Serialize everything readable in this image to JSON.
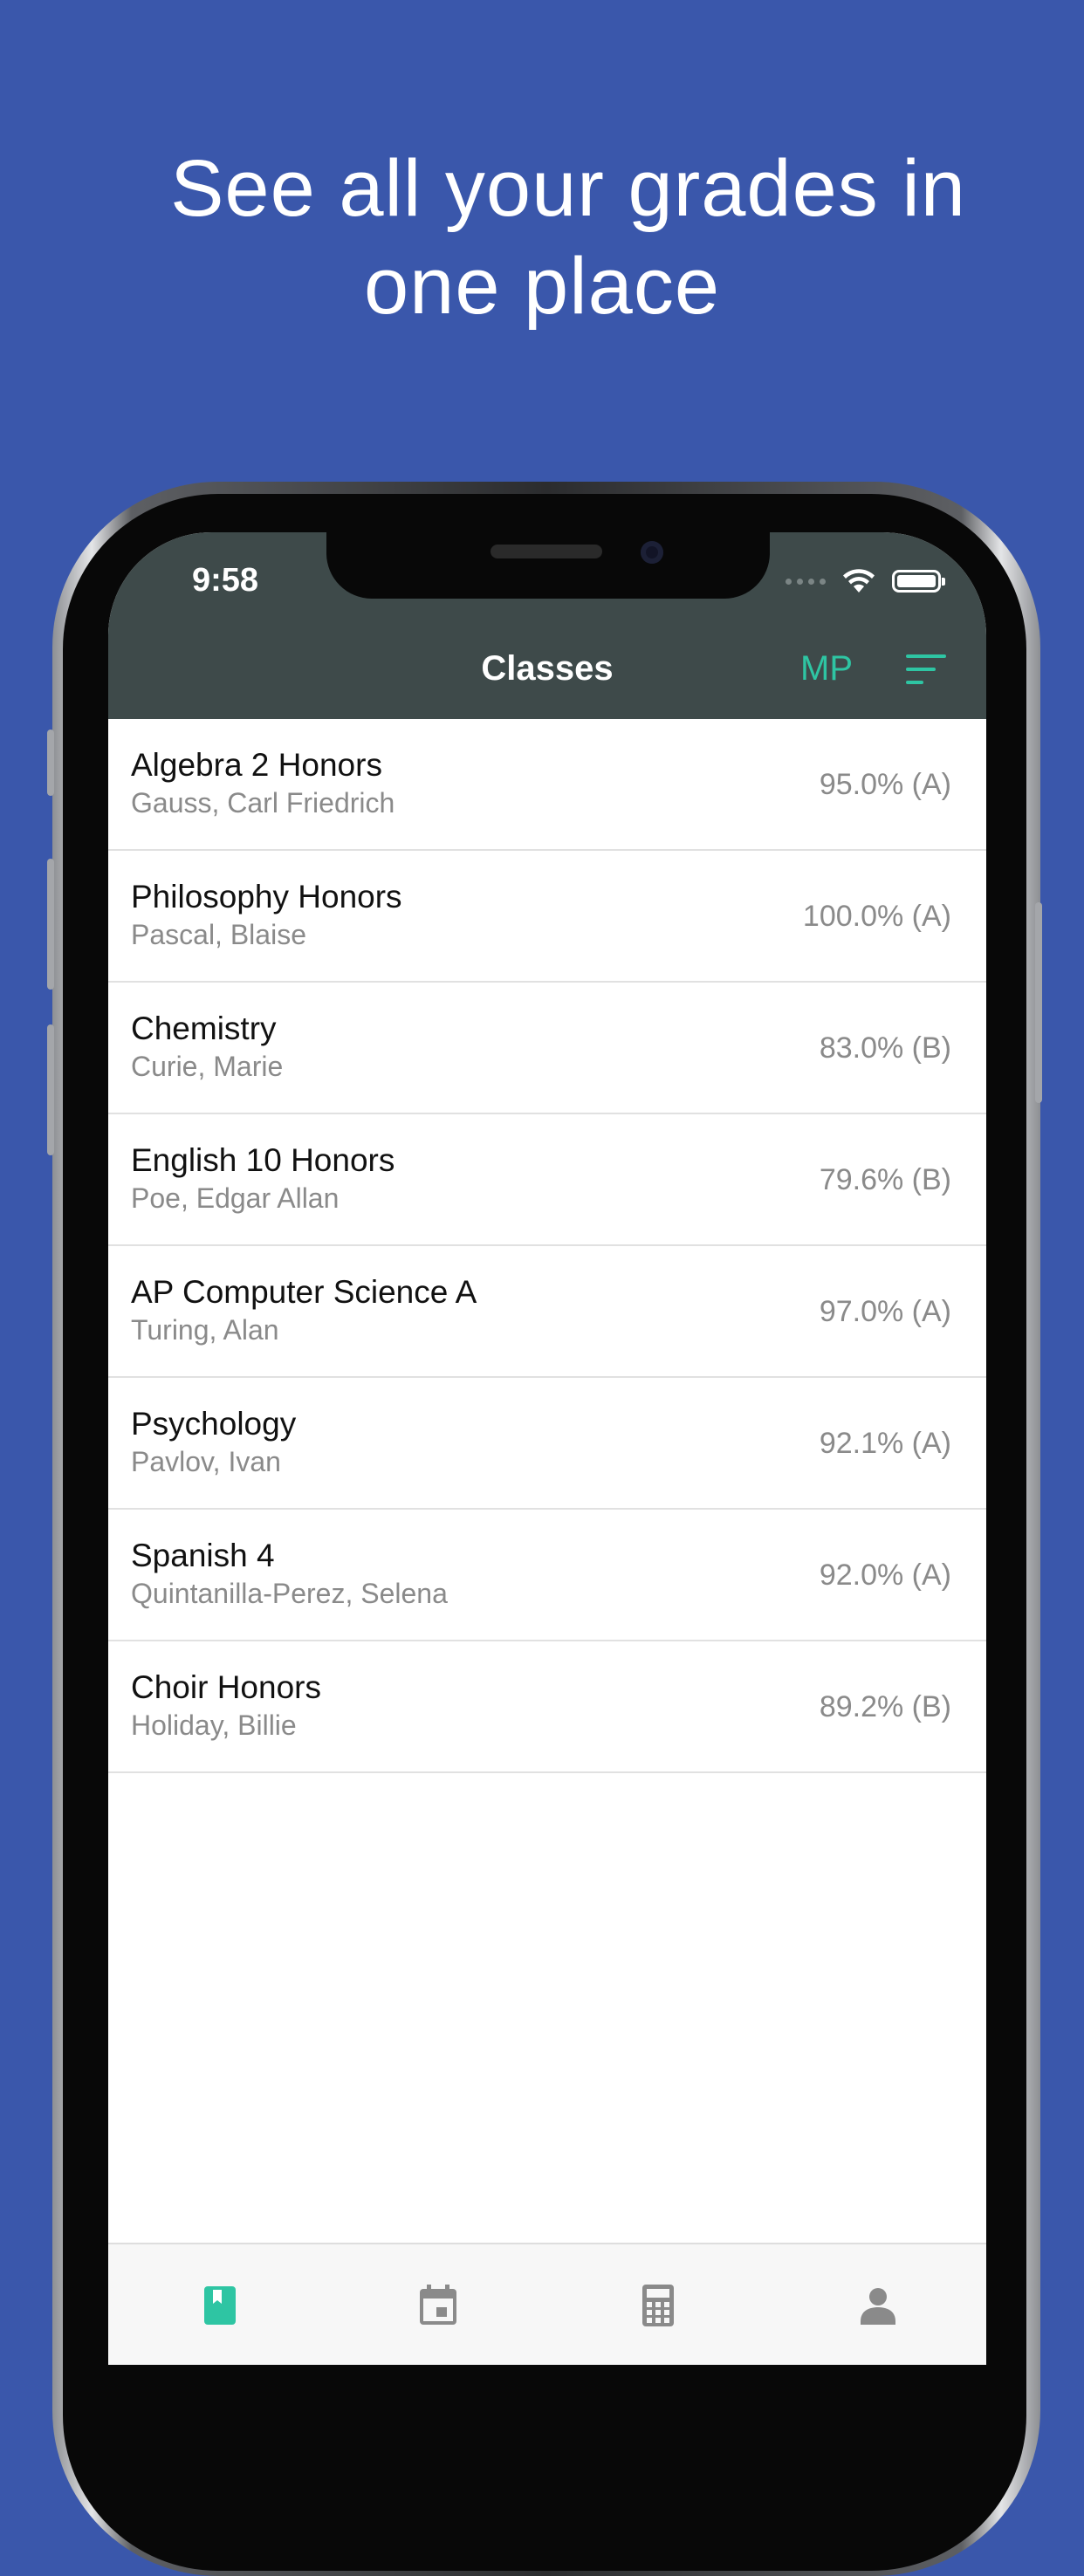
{
  "headline": {
    "line1": "See all your grades in",
    "line2": "one place"
  },
  "status_bar": {
    "time": "9:58"
  },
  "nav": {
    "title": "Classes",
    "mp_label": "MP",
    "filter_icon": "sort-icon"
  },
  "classes": [
    {
      "name": "Algebra 2 Honors",
      "teacher": "Gauss, Carl Friedrich",
      "grade": "95.0% (A)"
    },
    {
      "name": "Philosophy Honors",
      "teacher": "Pascal, Blaise",
      "grade": "100.0% (A)"
    },
    {
      "name": "Chemistry",
      "teacher": "Curie, Marie",
      "grade": "83.0% (B)"
    },
    {
      "name": "English 10 Honors",
      "teacher": "Poe, Edgar Allan",
      "grade": "79.6% (B)"
    },
    {
      "name": "AP Computer Science A",
      "teacher": "Turing, Alan",
      "grade": "97.0% (A)"
    },
    {
      "name": "Psychology",
      "teacher": "Pavlov, Ivan",
      "grade": "92.1% (A)"
    },
    {
      "name": "Spanish 4",
      "teacher": "Quintanilla-Perez, Selena",
      "grade": "92.0% (A)"
    },
    {
      "name": "Choir Honors",
      "teacher": "Holiday, Billie",
      "grade": "89.2% (B)"
    }
  ],
  "tabs": [
    {
      "icon": "book-icon",
      "active": true
    },
    {
      "icon": "calendar-icon",
      "active": false
    },
    {
      "icon": "calculator-icon",
      "active": false
    },
    {
      "icon": "person-icon",
      "active": false
    }
  ],
  "colors": {
    "background": "#3a57ab",
    "navbar": "#3e4a4a",
    "accent": "#2ec5a3",
    "inactive_icon": "#8a8a8a"
  }
}
